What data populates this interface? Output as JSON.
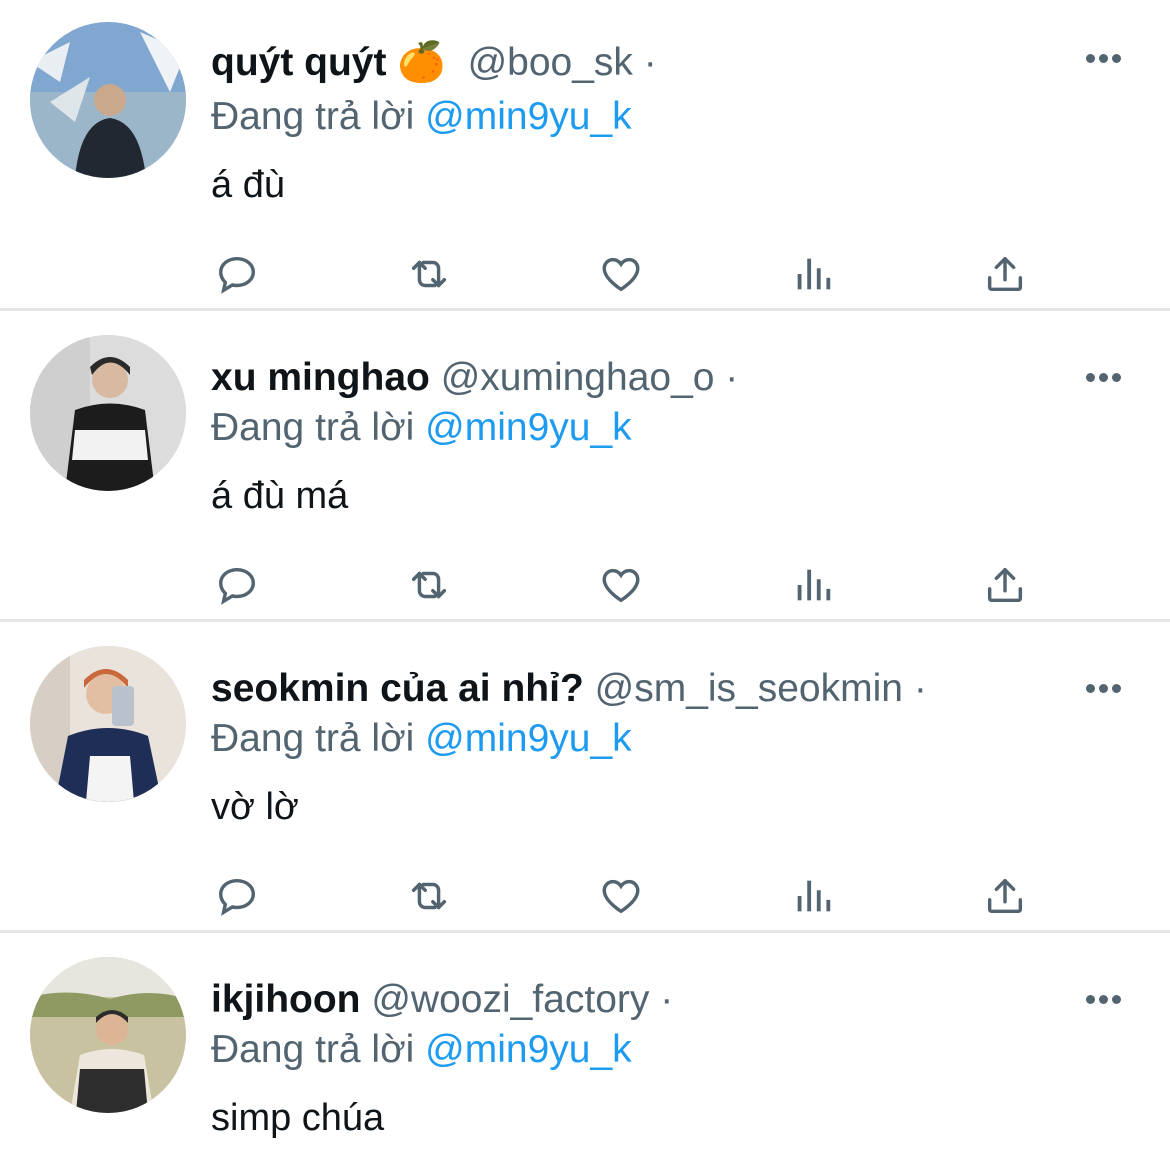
{
  "colors": {
    "text": "#0f1419",
    "secondary": "#536471",
    "mention": "#1d9bf0",
    "divider": "#e6e6e6"
  },
  "reply_prefix": "Đang trả lời",
  "action_icons": [
    "reply-icon",
    "retweet-icon",
    "like-icon",
    "analytics-icon",
    "share-icon"
  ],
  "tweets": [
    {
      "display_name": "quýt quýt",
      "emoji": "🍊",
      "handle": "@boo_sk",
      "separator": "·",
      "reply_to": "@min9yu_k",
      "text": "á đù"
    },
    {
      "display_name": "xu minghao",
      "emoji": "",
      "handle": "@xuminghao_o",
      "separator": "·",
      "reply_to": "@min9yu_k",
      "text": "á đù má"
    },
    {
      "display_name": "seokmin của ai nhỉ?",
      "emoji": "",
      "handle": "@sm_is_seokmin",
      "separator": "·",
      "reply_to": "@min9yu_k",
      "text": "vờ lờ"
    },
    {
      "display_name": "ikjihoon",
      "emoji": "",
      "handle": "@woozi_factory",
      "separator": "·",
      "reply_to": "@min9yu_k",
      "text": "simp chúa"
    }
  ]
}
